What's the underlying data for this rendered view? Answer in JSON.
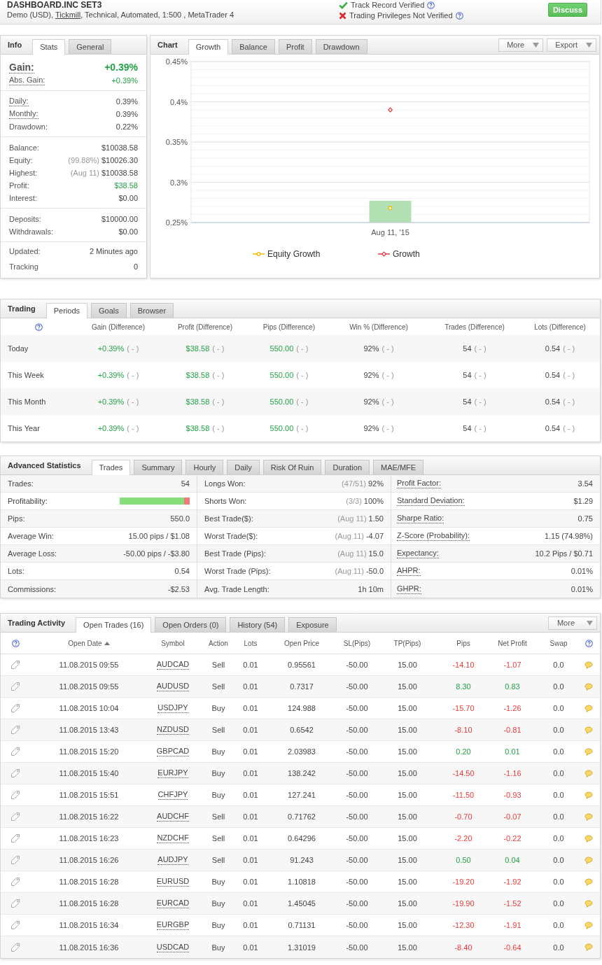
{
  "header": {
    "title": "DASHBOARD.INC SET3",
    "details": {
      "before": "Demo (USD), ",
      "link": "Tickmill",
      "after": ", Technical, Automated, 1:500 , MetaTrader 4"
    },
    "verifications": [
      {
        "text": "Track Record Verified",
        "verified": true
      },
      {
        "text": "Trading Privileges Not Verified",
        "verified": false
      }
    ],
    "action_button": "Discuss"
  },
  "info": {
    "title": "Info",
    "tabs": [
      {
        "label": "Stats",
        "selected": true
      },
      {
        "label": "General",
        "selected": false
      }
    ],
    "groups": [
      {
        "rows": [
          {
            "label": "Gain:",
            "value": "+0.39%",
            "kind": "headline",
            "positive": true,
            "tooltip": true
          },
          {
            "label": "Abs. Gain:",
            "value": "+0.39%",
            "kind": "plain",
            "positive": true,
            "tooltip": true
          }
        ]
      },
      {
        "rows": [
          {
            "label": "Daily:",
            "value": "0.39%",
            "kind": "plain",
            "positive": false,
            "tooltip": true
          },
          {
            "label": "Monthly:",
            "value": "0.39%",
            "kind": "plain",
            "positive": false,
            "tooltip": true
          },
          {
            "label": "Drawdown:",
            "value": "0.22%",
            "kind": "plain",
            "positive": false,
            "tooltip": false
          }
        ]
      },
      {
        "rows": [
          {
            "label": "Balance:",
            "value": "$10038.58",
            "kind": "plain",
            "positive": false,
            "tooltip": false
          },
          {
            "label": "Equity:",
            "note": "(99.88%)",
            "value": "$10026.30",
            "kind": "plain",
            "positive": false,
            "tooltip": false
          },
          {
            "label": "Highest:",
            "note": "(Aug 11)",
            "value": "$10038.58",
            "kind": "plain",
            "positive": false,
            "tooltip": false
          },
          {
            "label": "Profit:",
            "value": "$38.58",
            "kind": "plain",
            "positive": true,
            "tooltip": false
          },
          {
            "label": "Interest:",
            "value": "$0.00",
            "kind": "plain",
            "positive": false,
            "tooltip": false
          }
        ]
      },
      {
        "rows": [
          {
            "label": "Deposits:",
            "value": "$10000.00",
            "kind": "plain",
            "positive": false,
            "tooltip": false
          },
          {
            "label": "Withdrawals:",
            "value": "$0.00",
            "kind": "plain",
            "positive": false,
            "tooltip": false
          }
        ]
      },
      {
        "rows": [
          {
            "label": "Updated:",
            "value": "2 Minutes ago",
            "kind": "plain",
            "positive": false,
            "tooltip": false
          },
          {
            "label": "Tracking",
            "value": "0",
            "kind": "plain",
            "positive": false,
            "tooltip": false
          }
        ]
      }
    ]
  },
  "chart": {
    "title": "Chart",
    "tabs": [
      {
        "label": "Growth",
        "selected": true
      },
      {
        "label": "Balance",
        "selected": false
      },
      {
        "label": "Profit",
        "selected": false
      },
      {
        "label": "Drawdown",
        "selected": false
      }
    ],
    "buttons": [
      "More",
      "Export"
    ],
    "chart_data": {
      "type": "line",
      "categories": [
        "Aug 11, '15"
      ],
      "series": [
        {
          "name": "Equity Growth",
          "marker": "circle",
          "color": "#f5b800",
          "values": [
            0.268
          ]
        },
        {
          "name": "Growth",
          "marker": "diamond",
          "color": "#e8383d",
          "values": [
            0.39
          ]
        },
        {
          "type": "bar",
          "color": "#b3e0b3",
          "values": [
            0.277
          ]
        }
      ],
      "ylim": [
        0.25,
        0.45
      ],
      "yticks": [
        {
          "value": 0.25,
          "label": "0.25%"
        },
        {
          "value": 0.3,
          "label": "0.3%"
        },
        {
          "value": 0.35,
          "label": "0.35%"
        },
        {
          "value": 0.4,
          "label": "0.4%"
        },
        {
          "value": 0.45,
          "label": "0.45%"
        }
      ],
      "grid": true,
      "legend": "bottom"
    }
  },
  "trading": {
    "title": "Trading",
    "tabs": [
      {
        "label": "Periods",
        "selected": true
      },
      {
        "label": "Goals",
        "selected": false
      },
      {
        "label": "Browser",
        "selected": false
      }
    ],
    "columns": [
      "Gain (Difference)",
      "Profit (Difference)",
      "Pips (Difference)",
      "Win % (Difference)",
      "Trades (Difference)",
      "Lots (Difference)"
    ],
    "rows": [
      {
        "period": "Today",
        "cells": [
          {
            "value": "+0.39%",
            "difference": "( - )",
            "positive": true
          },
          {
            "value": "$38.58",
            "difference": "( - )",
            "positive": true
          },
          {
            "value": "550.00",
            "difference": "( - )",
            "positive": true
          },
          {
            "value": "92%",
            "difference": "( - )",
            "positive": false
          },
          {
            "value": "54",
            "difference": "( - )",
            "positive": false
          },
          {
            "value": "0.54",
            "difference": "( - )",
            "positive": false
          }
        ]
      },
      {
        "period": "This Week",
        "cells": [
          {
            "value": "+0.39%",
            "difference": "( - )",
            "positive": true
          },
          {
            "value": "$38.58",
            "difference": "( - )",
            "positive": true
          },
          {
            "value": "550.00",
            "difference": "( - )",
            "positive": true
          },
          {
            "value": "92%",
            "difference": "( - )",
            "positive": false
          },
          {
            "value": "54",
            "difference": "( - )",
            "positive": false
          },
          {
            "value": "0.54",
            "difference": "( - )",
            "positive": false
          }
        ]
      },
      {
        "period": "This Month",
        "cells": [
          {
            "value": "+0.39%",
            "difference": "( - )",
            "positive": true
          },
          {
            "value": "$38.58",
            "difference": "( - )",
            "positive": true
          },
          {
            "value": "550.00",
            "difference": "( - )",
            "positive": true
          },
          {
            "value": "92%",
            "difference": "( - )",
            "positive": false
          },
          {
            "value": "54",
            "difference": "( - )",
            "positive": false
          },
          {
            "value": "0.54",
            "difference": "( - )",
            "positive": false
          }
        ]
      },
      {
        "period": "This Year",
        "cells": [
          {
            "value": "+0.39%",
            "difference": "( - )",
            "positive": true
          },
          {
            "value": "$38.58",
            "difference": "( - )",
            "positive": true
          },
          {
            "value": "550.00",
            "difference": "( - )",
            "positive": true
          },
          {
            "value": "92%",
            "difference": "( - )",
            "positive": false
          },
          {
            "value": "54",
            "difference": "( - )",
            "positive": false
          },
          {
            "value": "0.54",
            "difference": "( - )",
            "positive": false
          }
        ]
      }
    ]
  },
  "advanced": {
    "title": "Advanced Statistics",
    "tabs": [
      {
        "label": "Trades",
        "selected": true
      },
      {
        "label": "Summary",
        "selected": false
      },
      {
        "label": "Hourly",
        "selected": false
      },
      {
        "label": "Daily",
        "selected": false
      },
      {
        "label": "Risk Of Ruin",
        "selected": false
      },
      {
        "label": "Duration",
        "selected": false
      },
      {
        "label": "MAE/MFE",
        "selected": false
      }
    ],
    "columns": [
      [
        {
          "label": "Trades:",
          "value": "54",
          "kind": "text",
          "tooltip": false
        },
        {
          "label": "Profitability:",
          "kind": "bar",
          "level": 0.92,
          "tooltip": false
        },
        {
          "label": "Pips:",
          "value": "550.0",
          "kind": "text",
          "tooltip": false
        },
        {
          "label": "Average Win:",
          "value": "15.00 pips / $1.08",
          "kind": "text",
          "tooltip": false
        },
        {
          "label": "Average Loss:",
          "value": "-50.00 pips / -$3.80",
          "kind": "text",
          "tooltip": false
        },
        {
          "label": "Lots:",
          "value": "0.54",
          "kind": "text",
          "tooltip": false
        },
        {
          "label": "Commissions:",
          "value": "-$2.53",
          "kind": "text",
          "tooltip": false
        }
      ],
      [
        {
          "label": "Longs Won:",
          "note": "(47/51)",
          "value": "92%",
          "kind": "text",
          "tooltip": false
        },
        {
          "label": "Shorts Won:",
          "note": "(3/3)",
          "value": "100%",
          "kind": "text",
          "tooltip": false
        },
        {
          "label": "Best Trade($):",
          "note": "(Aug 11)",
          "value": "1.50",
          "kind": "text",
          "tooltip": false
        },
        {
          "label": "Worst Trade($):",
          "note": "(Aug 11)",
          "value": "-4.07",
          "kind": "text",
          "tooltip": false
        },
        {
          "label": "Best Trade (Pips):",
          "note": "(Aug 11)",
          "value": "15.0",
          "kind": "text",
          "tooltip": false
        },
        {
          "label": "Worst Trade (Pips):",
          "note": "(Aug 11)",
          "value": "-50.0",
          "kind": "text",
          "tooltip": false
        },
        {
          "label": "Avg. Trade Length:",
          "value": "1h 10m",
          "kind": "text",
          "tooltip": false
        }
      ],
      [
        {
          "label": "Profit Factor:",
          "value": "3.54",
          "kind": "text",
          "tooltip": true
        },
        {
          "label": "Standard Deviation:",
          "value": "$1.29",
          "kind": "text",
          "tooltip": true
        },
        {
          "label": "Sharpe Ratio:",
          "value": "0.75",
          "kind": "text",
          "tooltip": true
        },
        {
          "label": "Z-Score (Probability):",
          "value": "1.15 (74.98%)",
          "kind": "text",
          "tooltip": true
        },
        {
          "label": "Expectancy:",
          "value": "10.2 Pips / $0.71",
          "kind": "text",
          "tooltip": true
        },
        {
          "label": "AHPR:",
          "value": "0.01%",
          "kind": "text",
          "tooltip": true
        },
        {
          "label": "GHPR:",
          "value": "0.01%",
          "kind": "text",
          "tooltip": true
        }
      ]
    ]
  },
  "activity": {
    "title": "Trading Activity",
    "tabs": [
      {
        "label": "Open Trades (16)",
        "selected": true
      },
      {
        "label": "Open Orders (0)",
        "selected": false
      },
      {
        "label": "History (54)",
        "selected": false
      },
      {
        "label": "Exposure",
        "selected": false
      }
    ],
    "button": "More",
    "columns": [
      {
        "label": "Open Date",
        "sorted": true
      },
      {
        "label": "Symbol",
        "sorted": false
      },
      {
        "label": "Action",
        "sorted": false
      },
      {
        "label": "Lots",
        "sorted": false
      },
      {
        "label": "Open Price",
        "sorted": false
      },
      {
        "label": "SL(Pips)",
        "sorted": false
      },
      {
        "label": "TP(Pips)",
        "sorted": false
      },
      {
        "label": "Pips",
        "sorted": false
      },
      {
        "label": "Net Profit",
        "sorted": false
      },
      {
        "label": "Swap",
        "sorted": false
      }
    ],
    "rows": [
      {
        "open_date": "11.08.2015 09:55",
        "symbol": "AUDCAD",
        "action": "Sell",
        "lots": "0.01",
        "open_price": "0.95561",
        "sl": "-50.00",
        "tp": "15.00",
        "pips": "-14.10",
        "net_profit": "-1.07",
        "swap": "0.0",
        "loss": true
      },
      {
        "open_date": "11.08.2015 09:55",
        "symbol": "AUDUSD",
        "action": "Sell",
        "lots": "0.01",
        "open_price": "0.7317",
        "sl": "-50.00",
        "tp": "15.00",
        "pips": "8.30",
        "net_profit": "0.83",
        "swap": "0.0",
        "loss": false
      },
      {
        "open_date": "11.08.2015 10:04",
        "symbol": "USDJPY",
        "action": "Buy",
        "lots": "0.01",
        "open_price": "124.988",
        "sl": "-50.00",
        "tp": "15.00",
        "pips": "-15.70",
        "net_profit": "-1.26",
        "swap": "0.0",
        "loss": true
      },
      {
        "open_date": "11.08.2015 13:43",
        "symbol": "NZDUSD",
        "action": "Sell",
        "lots": "0.01",
        "open_price": "0.6542",
        "sl": "-50.00",
        "tp": "15.00",
        "pips": "-8.10",
        "net_profit": "-0.81",
        "swap": "0.0",
        "loss": true
      },
      {
        "open_date": "11.08.2015 15:20",
        "symbol": "GBPCAD",
        "action": "Buy",
        "lots": "0.01",
        "open_price": "2.03983",
        "sl": "-50.00",
        "tp": "15.00",
        "pips": "0.20",
        "net_profit": "0.01",
        "swap": "0.0",
        "loss": false
      },
      {
        "open_date": "11.08.2015 15:40",
        "symbol": "EURJPY",
        "action": "Buy",
        "lots": "0.01",
        "open_price": "138.242",
        "sl": "-50.00",
        "tp": "15.00",
        "pips": "-14.50",
        "net_profit": "-1.16",
        "swap": "0.0",
        "loss": true
      },
      {
        "open_date": "11.08.2015 15:51",
        "symbol": "CHFJPY",
        "action": "Buy",
        "lots": "0.01",
        "open_price": "127.241",
        "sl": "-50.00",
        "tp": "15.00",
        "pips": "-11.50",
        "net_profit": "-0.93",
        "swap": "0.0",
        "loss": true
      },
      {
        "open_date": "11.08.2015 16:22",
        "symbol": "AUDCHF",
        "action": "Sell",
        "lots": "0.01",
        "open_price": "0.71762",
        "sl": "-50.00",
        "tp": "15.00",
        "pips": "-0.70",
        "net_profit": "-0.07",
        "swap": "0.0",
        "loss": true
      },
      {
        "open_date": "11.08.2015 16:23",
        "symbol": "NZDCHF",
        "action": "Sell",
        "lots": "0.01",
        "open_price": "0.64296",
        "sl": "-50.00",
        "tp": "15.00",
        "pips": "-2.20",
        "net_profit": "-0.22",
        "swap": "0.0",
        "loss": true
      },
      {
        "open_date": "11.08.2015 16:26",
        "symbol": "AUDJPY",
        "action": "Sell",
        "lots": "0.01",
        "open_price": "91.243",
        "sl": "-50.00",
        "tp": "15.00",
        "pips": "0.50",
        "net_profit": "0.04",
        "swap": "0.0",
        "loss": false
      },
      {
        "open_date": "11.08.2015 16:28",
        "symbol": "EURUSD",
        "action": "Buy",
        "lots": "0.01",
        "open_price": "1.10818",
        "sl": "-50.00",
        "tp": "15.00",
        "pips": "-19.20",
        "net_profit": "-1.92",
        "swap": "0.0",
        "loss": true
      },
      {
        "open_date": "11.08.2015 16:28",
        "symbol": "EURCAD",
        "action": "Buy",
        "lots": "0.01",
        "open_price": "1.45045",
        "sl": "-50.00",
        "tp": "15.00",
        "pips": "-19.90",
        "net_profit": "-1.52",
        "swap": "0.0",
        "loss": true
      },
      {
        "open_date": "11.08.2015 16:34",
        "symbol": "EURGBP",
        "action": "Buy",
        "lots": "0.01",
        "open_price": "0.71131",
        "sl": "-50.00",
        "tp": "15.00",
        "pips": "-12.30",
        "net_profit": "-1.91",
        "swap": "0.0",
        "loss": true
      },
      {
        "open_date": "11.08.2015 16:36",
        "symbol": "USDCAD",
        "action": "Buy",
        "lots": "0.01",
        "open_price": "1.31019",
        "sl": "-50.00",
        "tp": "15.00",
        "pips": "-8.40",
        "net_profit": "-0.64",
        "swap": "0.0",
        "loss": true
      }
    ]
  }
}
